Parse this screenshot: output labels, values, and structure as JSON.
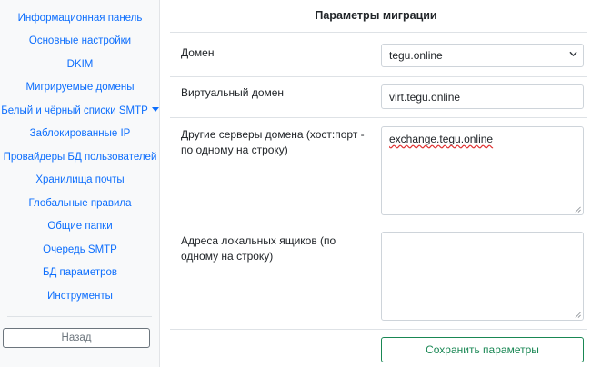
{
  "sidebar": {
    "items": [
      {
        "label": "Информационная панель"
      },
      {
        "label": "Основные настройки"
      },
      {
        "label": "DKIM"
      },
      {
        "label": "Мигрируемые домены"
      },
      {
        "label": "Белый и чёрный списки SMTP"
      },
      {
        "label": "Заблокированные IP"
      },
      {
        "label": "Провайдеры БД пользователей"
      },
      {
        "label": "Хранилища почты"
      },
      {
        "label": "Глобальные правила"
      },
      {
        "label": "Общие папки"
      },
      {
        "label": "Очередь SMTP"
      },
      {
        "label": "БД параметров"
      },
      {
        "label": "Инструменты"
      }
    ],
    "back_label": "Назад"
  },
  "main": {
    "title": "Параметры миграции",
    "domain": {
      "label": "Домен",
      "value": "tegu.online"
    },
    "virtual_domain": {
      "label": "Виртуальный домен",
      "value": "virt.tegu.online"
    },
    "other_servers": {
      "label": "Другие серверы домена (хост:порт - по одному на строку)",
      "value": "exchange.tegu.online"
    },
    "local_mailboxes": {
      "label": "Адреса локальных ящиков (по одному на строку)",
      "value": ""
    },
    "save_label": "Сохранить параметры"
  },
  "colors": {
    "link": "#0d6efd",
    "save": "#198754",
    "back": "#6c757d"
  },
  "icons": {
    "dropdown": "caret-down-icon",
    "select": "chevron-down-icon",
    "resize": "resize-grip-icon"
  }
}
